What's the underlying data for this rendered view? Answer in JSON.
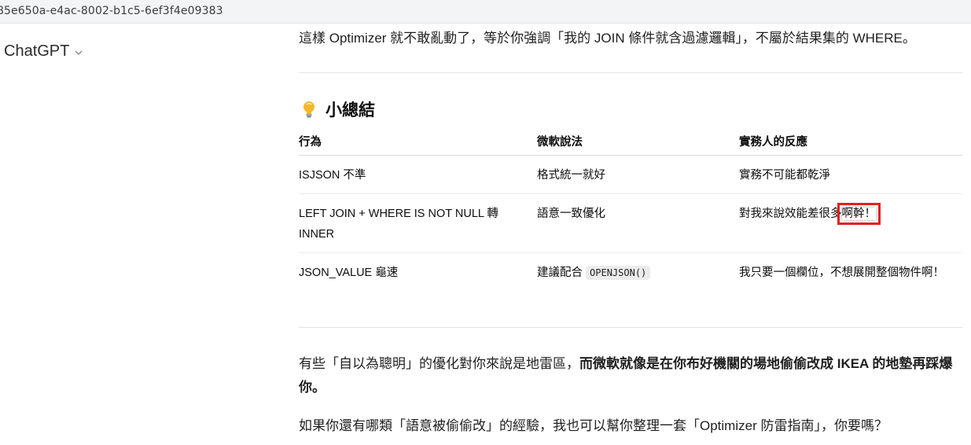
{
  "browser": {
    "url_fragment": "85e650a-e4ac-8002-b1c5-6ef3f4e09383"
  },
  "header": {
    "model_label": "ChatGPT"
  },
  "message": {
    "intro_line": "這樣 Optimizer 就不敢亂動了，等於你強調「我的 JOIN 條件就含過濾邏輯」，不屬於結果集的 WHERE。",
    "section_title": "小總結",
    "table": {
      "headers": [
        "行為",
        "微軟說法",
        "實務人的反應"
      ],
      "rows": [
        {
          "behavior": "ISJSON 不準",
          "ms": "格式統一就好",
          "reaction": "實務不可能都乾淨"
        },
        {
          "behavior": "LEFT JOIN + WHERE IS NOT NULL 轉 INNER",
          "ms": "語意一致優化",
          "reaction_before": "對我來說效能差很多",
          "reaction_highlight": "啊幹！"
        },
        {
          "behavior": "JSON_VALUE 龜速",
          "ms_text": "建議配合",
          "ms_code": "OPENJSON()",
          "reaction": "我只要一個欄位，不想展開整個物件啊！"
        }
      ]
    },
    "para1_normal": "有些「自以為聰明」的優化對你來說是地雷區，",
    "para1_bold": "而微軟就像是在你布好機關的場地偷偷改成 IKEA 的地墊再踩爆你。",
    "para2": "如果你還有哪類「語意被偷偷改」的經驗，我也可以幫你整理一套「Optimizer 防雷指南」，你要嗎？"
  },
  "colors": {
    "highlight_border": "#e02020",
    "divider": "#e5e5e5",
    "code_bg": "#ececec"
  },
  "icons": {
    "bulb": "lightbulb-icon",
    "chevron": "chevron-down-icon"
  }
}
